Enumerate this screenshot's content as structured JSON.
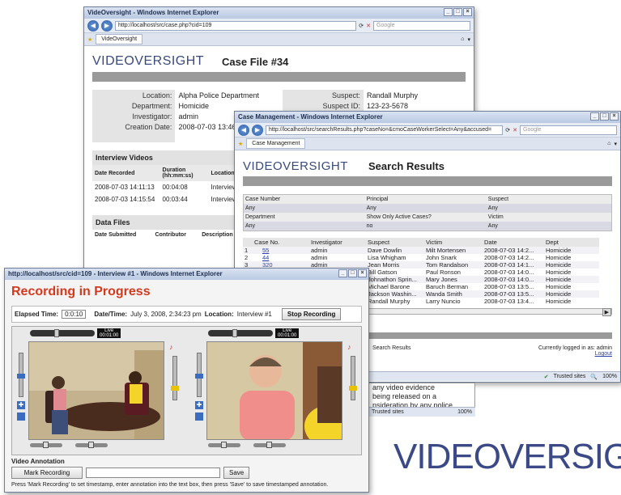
{
  "case_window": {
    "title": "VideOversight - Windows Internet Explorer",
    "url": "http://localhost/src/case.php?cid=109",
    "search_placeholder": "Google",
    "tab": "VideOversight",
    "logo": "VIDEOVERSIGHT",
    "heading": "Case File #34",
    "fields": [
      {
        "label": "Location:",
        "value": "Alpha Police Department"
      },
      {
        "label": "Department:",
        "value": "Homicide"
      },
      {
        "label": "Investigator:",
        "value": "admin"
      },
      {
        "label": "Creation Date:",
        "value": "2008-07-03 13:46"
      }
    ],
    "suspect_fields": [
      {
        "label": "Suspect:",
        "value": "Randall Murphy"
      },
      {
        "label": "Suspect ID:",
        "value": "123-23-5678"
      }
    ],
    "interview_videos": {
      "title": "Interview Videos",
      "headers": [
        "Date Recorded",
        "Duration (hh:mm:ss)",
        "Location"
      ],
      "rows": [
        [
          "2008-07-03 14:11:13",
          "00:04:08",
          "Interview #"
        ],
        [
          "2008-07-03 14:15:54",
          "00:03:44",
          "Interview #"
        ]
      ]
    },
    "data_files": {
      "title": "Data Files",
      "headers": [
        "Date Submitted",
        "Contributor",
        "Description"
      ]
    }
  },
  "search_window": {
    "title": "Case Management - Windows Internet Explorer",
    "url": "http://localhost/src/searchResults.php?caseNo=&cmoCaseWorkerSelect=Any&accused=",
    "search_placeholder": "Google",
    "tab": "Case Management",
    "logo": "VIDEOVERSIGHT",
    "heading": "Search Results",
    "criteria": [
      {
        "label": "Case Number",
        "value": "Any"
      },
      {
        "label": "Principal",
        "value": "Any"
      },
      {
        "label": "Suspect",
        "value": "Any"
      },
      {
        "label": "Department",
        "value": "Any"
      },
      {
        "label": "Show Only Active Cases?",
        "value": "no"
      },
      {
        "label": "Victim",
        "value": "Any"
      }
    ],
    "results_headers": [
      "Case No.",
      "Investigator",
      "Suspect",
      "Victim",
      "Date",
      "Dept"
    ],
    "results": [
      {
        "n": "1",
        "case": "55",
        "inv": "admin",
        "suspect": "Dave Dowlin",
        "victim": "Milt Mortensen",
        "date": "2008-07-03 14:2...",
        "dept": "Homicide"
      },
      {
        "n": "2",
        "case": "44",
        "inv": "admin",
        "suspect": "Lisa Whigham",
        "victim": "John Snark",
        "date": "2008-07-03 14:2...",
        "dept": "Homicide"
      },
      {
        "n": "3",
        "case": "320",
        "inv": "admin",
        "suspect": "Jean Morris",
        "victim": "Tom Randalson",
        "date": "2008-07-03 14:1...",
        "dept": "Homicide"
      },
      {
        "n": "",
        "case": "",
        "inv": "admin",
        "suspect": "Bill Gatson",
        "victim": "Paul Ronson",
        "date": "2008-07-03 14:0...",
        "dept": "Homicide"
      },
      {
        "n": "",
        "case": "",
        "inv": "admin",
        "suspect": "Johnathon Sprin...",
        "victim": "Mary Jones",
        "date": "2008-07-03 14:0...",
        "dept": "Homicide"
      },
      {
        "n": "",
        "case": "",
        "inv": "admin",
        "suspect": "Michael Barone",
        "victim": "Baruch Berman",
        "date": "2008-07-03 13:5...",
        "dept": "Homicide"
      },
      {
        "n": "",
        "case": "",
        "inv": "admin",
        "suspect": "Jackson Washin...",
        "victim": "Wanda Smith",
        "date": "2008-07-03 13:5...",
        "dept": "Homicide"
      },
      {
        "n": "",
        "case": "",
        "inv": "admin",
        "suspect": "Randall Murphy",
        "victim": "Larry Nuncio",
        "date": "2008-07-03 13:4...",
        "dept": "Homicide"
      }
    ],
    "footer_left": "Search Results",
    "logged_in": "Currently logged in as: admin",
    "logout": "Logout",
    "status_zone": "Trusted sites",
    "zoom": "100%",
    "paragraph": [
      "any video evidence",
      "being released on a",
      "nsideration by any police"
    ],
    "para_status": "Trusted sites",
    "para_zoom": "100%"
  },
  "recording_window": {
    "title": "http://localhost/src/cid=109 - Interview #1 - Windows Internet Explorer",
    "heading": "Recording in Progress",
    "elapsed_label": "Elapsed Time:",
    "elapsed_value": "0:0:10",
    "date_label": "Date/Time:",
    "date_value": "July 3, 2008, 2:34:23 pm",
    "location_label": "Location:",
    "location_value": "Interview #1",
    "stop_button": "Stop Recording",
    "live_label": "Live",
    "live_time": "00:01:00",
    "annotation_label": "Video Annotation",
    "mark_button": "Mark Recording",
    "save_button": "Save",
    "instructions": "Press 'Mark Recording' to set timestamp, enter annotation into the text box, then press 'Save' to save timestamped annotation."
  },
  "brand_logo": "VIDEOVERSIGH"
}
